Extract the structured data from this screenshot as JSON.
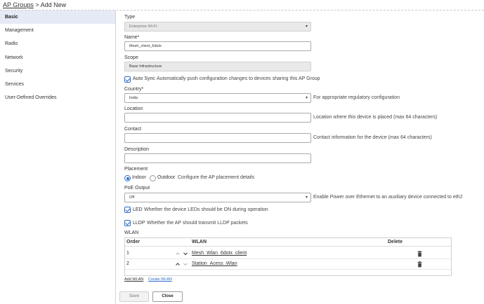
{
  "breadcrumb": {
    "parent": "AP Groups",
    "separator": ">",
    "current": "Add New"
  },
  "sidebar": {
    "items": [
      {
        "label": "Basic",
        "active": true
      },
      {
        "label": "Management"
      },
      {
        "label": "Radio"
      },
      {
        "label": "Network"
      },
      {
        "label": "Security"
      },
      {
        "label": "Services"
      },
      {
        "label": "User-Defined Overrides"
      }
    ]
  },
  "form": {
    "type": {
      "label": "Type",
      "value": "Enterprise Wi-Fi"
    },
    "name": {
      "label": "Name*",
      "value": "Mesh_client_6dotx"
    },
    "scope": {
      "label": "Scope",
      "value": "Base Infrastructure"
    },
    "auto_sync": {
      "label": "Auto Sync",
      "helper": "Automatically push configuration changes to devices sharing this AP Group",
      "checked": true
    },
    "country": {
      "label": "Country*",
      "value": "India",
      "helper": "For appropriate regulatory configuration"
    },
    "location": {
      "label": "Location",
      "value": "",
      "helper": "Location where this device is placed (max 64 characters)"
    },
    "contact": {
      "label": "Contact",
      "value": "",
      "helper": "Contact information for the device (max 64 characters)"
    },
    "description": {
      "label": "Description",
      "value": ""
    },
    "placement": {
      "label": "Placement",
      "indoor": "Indoor",
      "outdoor": "Outdoor",
      "helper": "Configure the AP placement details",
      "selected": "Indoor"
    },
    "poe_output": {
      "label": "PoE Output",
      "value": "Off",
      "helper": "Enable Power over Ethernet to an auxiliary device connected to eth2"
    },
    "led": {
      "label": "LED",
      "helper": "Whether the device LEDs should be ON during operation",
      "checked": true
    },
    "lldp": {
      "label": "LLDP",
      "helper": "Whether the AP should transmit LLDP packets",
      "checked": true
    }
  },
  "wlan": {
    "label": "WLAN",
    "columns": {
      "order": "Order",
      "wlan": "WLAN",
      "delete": "Delete"
    },
    "rows": [
      {
        "order": "1",
        "name": "Mesh_Wlan_6dotx_client"
      },
      {
        "order": "2",
        "name": "Station_Acess_Wlan"
      }
    ],
    "add_link": "Add WLAN",
    "create_link": "Create WLAN"
  },
  "buttons": {
    "save": "Save",
    "close": "Close"
  },
  "colors": {
    "accent": "#2b6cc4",
    "sidebar_active": "#e6eaf6",
    "link": "#2b6cc4"
  },
  "icons": {
    "caret": "chevron-down-icon",
    "up": "chevron-up-icon",
    "down": "chevron-down-icon",
    "delete": "trash-icon",
    "check": "check-icon"
  }
}
